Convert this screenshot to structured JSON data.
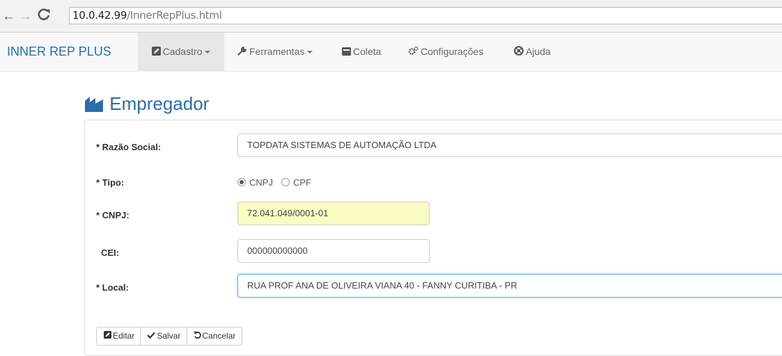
{
  "browser": {
    "address_host": "10.0.42.99",
    "address_path": "/InnerRepPlus.html"
  },
  "navbar": {
    "brand": "INNER REP PLUS",
    "items": [
      {
        "label": "Cadastro",
        "icon": "edit-icon",
        "dropdown": true,
        "active": true
      },
      {
        "label": "Ferramentas",
        "icon": "wrench-icon",
        "dropdown": true,
        "active": false
      },
      {
        "label": "Coleta",
        "icon": "inbox-icon",
        "dropdown": false,
        "active": false
      },
      {
        "label": "Configurações",
        "icon": "cogs-icon",
        "dropdown": false,
        "active": false
      },
      {
        "label": "Ajuda",
        "icon": "lifebuoy-icon",
        "dropdown": false,
        "active": false
      }
    ]
  },
  "page": {
    "title": "Empregador",
    "title_icon": "industry-chart-icon"
  },
  "form": {
    "razao_social": {
      "label": "* Razão Social:",
      "value": "TOPDATA SISTEMAS DE AUTOMAÇÃO LTDA"
    },
    "tipo": {
      "label": "* Tipo:",
      "options": [
        {
          "label": "CNPJ",
          "checked": true
        },
        {
          "label": "CPF",
          "checked": false
        }
      ]
    },
    "cnpj": {
      "label": "* CNPJ:",
      "value": "72.041.049/0001-01"
    },
    "cei": {
      "label": "CEI:",
      "value": "000000000000"
    },
    "local": {
      "label": "* Local:",
      "value": "RUA PROF ANA DE OLIVEIRA VIANA 40 - FANNY CURITIBA - PR"
    }
  },
  "actions": {
    "edit_label": "Editar",
    "save_label": "Salvar",
    "cancel_label": "Cancelar"
  },
  "colors": {
    "brand": "#2c6da6",
    "navbar_bg": "#f8f8f8",
    "active_nav_bg": "#e7e7e7",
    "highlight_input_bg": "#fafcc4",
    "focus_border": "#66afe9"
  }
}
